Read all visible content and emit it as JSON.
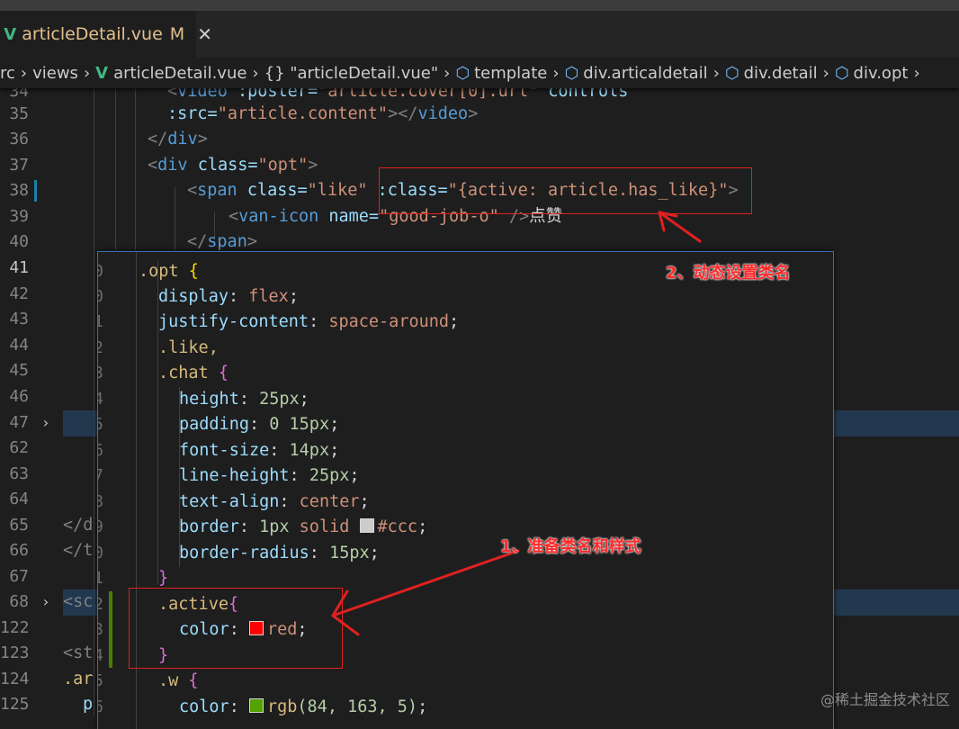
{
  "tab": {
    "icon": "vue-icon",
    "title": "articleDetail.vue",
    "modified": "M",
    "close": "✕"
  },
  "breadcrumbs": [
    "rc",
    "views",
    "articleDetail.vue",
    "{} \"articleDetail.vue\"",
    "template",
    "div.articaldetail",
    "div.detail",
    "div.opt"
  ],
  "editor_lines": [
    {
      "ln": "34",
      "code": "partial"
    },
    {
      "ln": "35"
    },
    {
      "ln": "36"
    },
    {
      "ln": "37"
    },
    {
      "ln": "38"
    },
    {
      "ln": "39"
    },
    {
      "ln": "40"
    },
    {
      "ln": "41"
    },
    {
      "ln": "42"
    },
    {
      "ln": "43"
    },
    {
      "ln": "44"
    },
    {
      "ln": "45"
    },
    {
      "ln": "46"
    },
    {
      "ln": "47"
    },
    {
      "ln": "62"
    },
    {
      "ln": "63"
    },
    {
      "ln": "64"
    },
    {
      "ln": "65"
    },
    {
      "ln": "66"
    },
    {
      "ln": "67"
    },
    {
      "ln": "68"
    },
    {
      "ln": "122"
    },
    {
      "ln": "123"
    },
    {
      "ln": "124"
    },
    {
      "ln": "125"
    }
  ],
  "code": {
    "l34": {
      "a": "<",
      "tag": "video",
      "attr": " :poster=",
      "str": "\"article.cover[0].url\"",
      "attr2": " controls"
    },
    "l35": {
      "attr": ":src=",
      "str": "\"article.content\"",
      "close": "></",
      "tag": "video",
      "end": ">"
    },
    "l36": {
      "open": "</",
      "tag": "div",
      "end": ">"
    },
    "l37": {
      "open": "<",
      "tag": "div",
      "attr": " class=",
      "str": "\"opt\"",
      "end": ">"
    },
    "l38": {
      "open": "<",
      "tag": "span",
      "attr": " class=",
      "str": "\"like\"",
      "attr2": " :class=",
      "str2": "\"{active: article.has_like}\"",
      "end": ">"
    },
    "l39": {
      "open": "<",
      "tag": "van-icon",
      "attr": " name=",
      "str": "\"good-job-o\"",
      "end": " />",
      "text": "点赞"
    },
    "l40": {
      "open": "</",
      "tag": "span",
      "end": ">"
    },
    "l65": "</d",
    "l66": "</t",
    "l68": "<sc",
    "l123": "<st",
    "l124": ".ar",
    "l125": "p"
  },
  "peek": {
    "lines": [
      {
        "n": "0",
        "sel": ".opt",
        "brace": " {"
      },
      {
        "n": "0",
        "prop": "display",
        "val": "flex"
      },
      {
        "n": "1",
        "prop": "justify-content",
        "val": "space-around"
      },
      {
        "n": "2",
        "sel": ".like,"
      },
      {
        "n": "3",
        "sel": ".chat",
        "brace": " {"
      },
      {
        "n": "4",
        "prop": "height",
        "num": "25px"
      },
      {
        "n": "5",
        "prop": "padding",
        "num": "0 15px"
      },
      {
        "n": "6",
        "prop": "font-size",
        "num": "14px"
      },
      {
        "n": "7",
        "prop": "line-height",
        "num": "25px"
      },
      {
        "n": "8",
        "prop": "text-align",
        "val": "center"
      },
      {
        "n": "9",
        "prop": "border",
        "num": "1px",
        "val": " solid ",
        "swatch": "#cccccc",
        "hex": "#ccc"
      },
      {
        "n": "0",
        "prop": "border-radius",
        "num": "15px"
      },
      {
        "n": "1",
        "close": "}"
      },
      {
        "n": "2",
        "sel": ".active",
        "brace": "{"
      },
      {
        "n": "3",
        "prop": "color",
        "swatch": "#ff0000",
        "val": "red"
      },
      {
        "n": "4",
        "close": "}"
      },
      {
        "n": "5",
        "sel": ".w",
        "brace": " {"
      },
      {
        "n": "6",
        "prop": "color",
        "swatch": "#54a305",
        "fn": "rgb",
        "args": "(84, 163, 5)"
      }
    ]
  },
  "annotations": {
    "a1": "1、准备类名和样式",
    "a2": "2、动态设置类名"
  },
  "watermark": "@稀土掘金技术社区",
  "colors": {
    "accent": "#3a6fb0",
    "annotation": "#e02020"
  }
}
